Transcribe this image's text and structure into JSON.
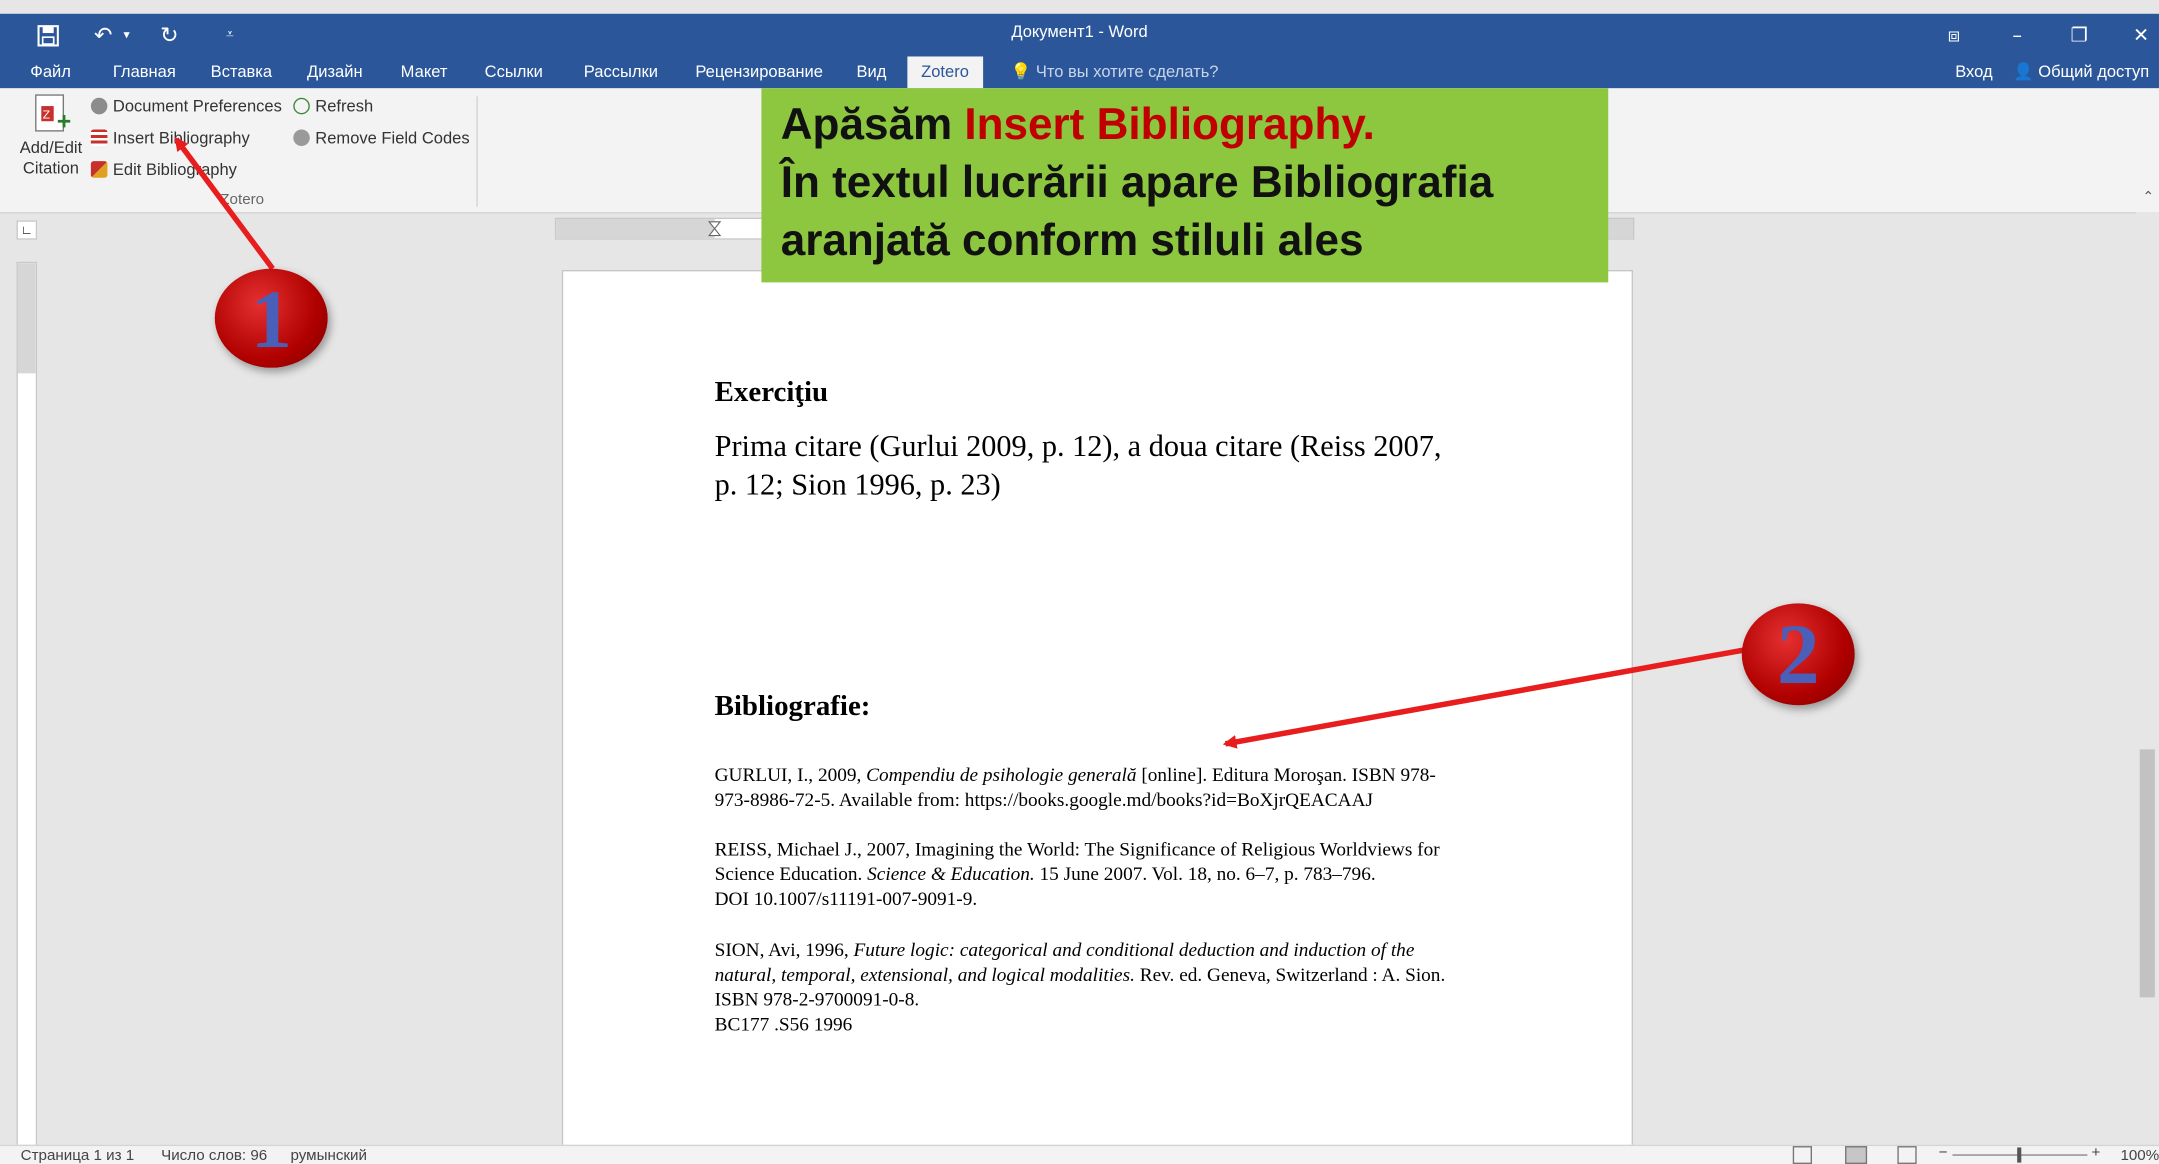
{
  "window": {
    "title": "Документ1 - Word"
  },
  "quick_access": {
    "save_icon": "save-icon",
    "undo_icon": "undo-icon",
    "redo_icon": "redo-icon",
    "customize_icon": "customize-icon"
  },
  "tabs": [
    "Файл",
    "Главная",
    "Вставка",
    "Дизайн",
    "Макет",
    "Ссылки",
    "Рассылки",
    "Рецензирование",
    "Вид",
    "Zotero"
  ],
  "tell_me": "Что вы хотите сделать?",
  "account": {
    "sign_in": "Вход",
    "share": "Общий доступ"
  },
  "ribbon": {
    "add_edit_citation_line1": "Add/Edit",
    "add_edit_citation_line2": "Citation",
    "document_preferences": "Document Preferences",
    "insert_bibliography": "Insert Bibliography",
    "edit_bibliography": "Edit Bibliography",
    "refresh": "Refresh",
    "remove_field_codes": "Remove Field Codes",
    "group_label": "Zotero"
  },
  "callout": {
    "line1_prefix": "Apăsăm ",
    "line1_highlight": "Insert Bibliography.",
    "line2": "În textul lucrării apare Bibliografia",
    "line3": "aranjată conform stiluli ales"
  },
  "badges": {
    "one": "1",
    "two": "2"
  },
  "document": {
    "heading": "Exerciţiu",
    "paragraph_line1": "Prima citare (Gurlui 2009, p. 12), a doua citare (Reiss 2007,",
    "paragraph_line2": "p. 12; Sion 1996, p. 23)",
    "bib_heading": "Bibliografie:",
    "bib1": {
      "a": "GURLUI, I., 2009, ",
      "b_italic": "Compendiu de psihologie generală",
      "c": " [online]. Editura Moroşan. ISBN 978-",
      "line2": "973-8986-72-5. Available from: https://books.google.md/books?id=BoXjrQEACAAJ"
    },
    "bib2": {
      "line1": "REISS, Michael J., 2007, Imagining the World: The Significance of Religious Worldviews for",
      "a": "Science Education. ",
      "b_italic": "Science & Education.",
      "c": " 15 June 2007. Vol. 18, no. 6–7, p. 783–796.",
      "line3": "DOI 10.1007/s11191-007-9091-9."
    },
    "bib3": {
      "a": "SION, Avi, 1996, ",
      "b_italic": "Future logic: categorical and conditional deduction and induction of the",
      "c_italic": "natural, temporal, extensional, and logical modalities.",
      "d": " Rev. ed. Geneva, Switzerland : A. Sion.",
      "line3": "ISBN 978-2-9700091-0-8.",
      "line4": "BC177 .S56 1996"
    }
  },
  "status": {
    "page": "Страница 1 из 1",
    "words": "Число слов: 96",
    "language": "румынский",
    "zoom": "100%"
  },
  "colors": {
    "title_bar": "#2b579a",
    "callout_bg": "#8dc63f",
    "callout_highlight": "#c00000",
    "arrow": "#e81e1e",
    "badge_red": "#b00000",
    "badge_number": "#4a5fb8"
  }
}
